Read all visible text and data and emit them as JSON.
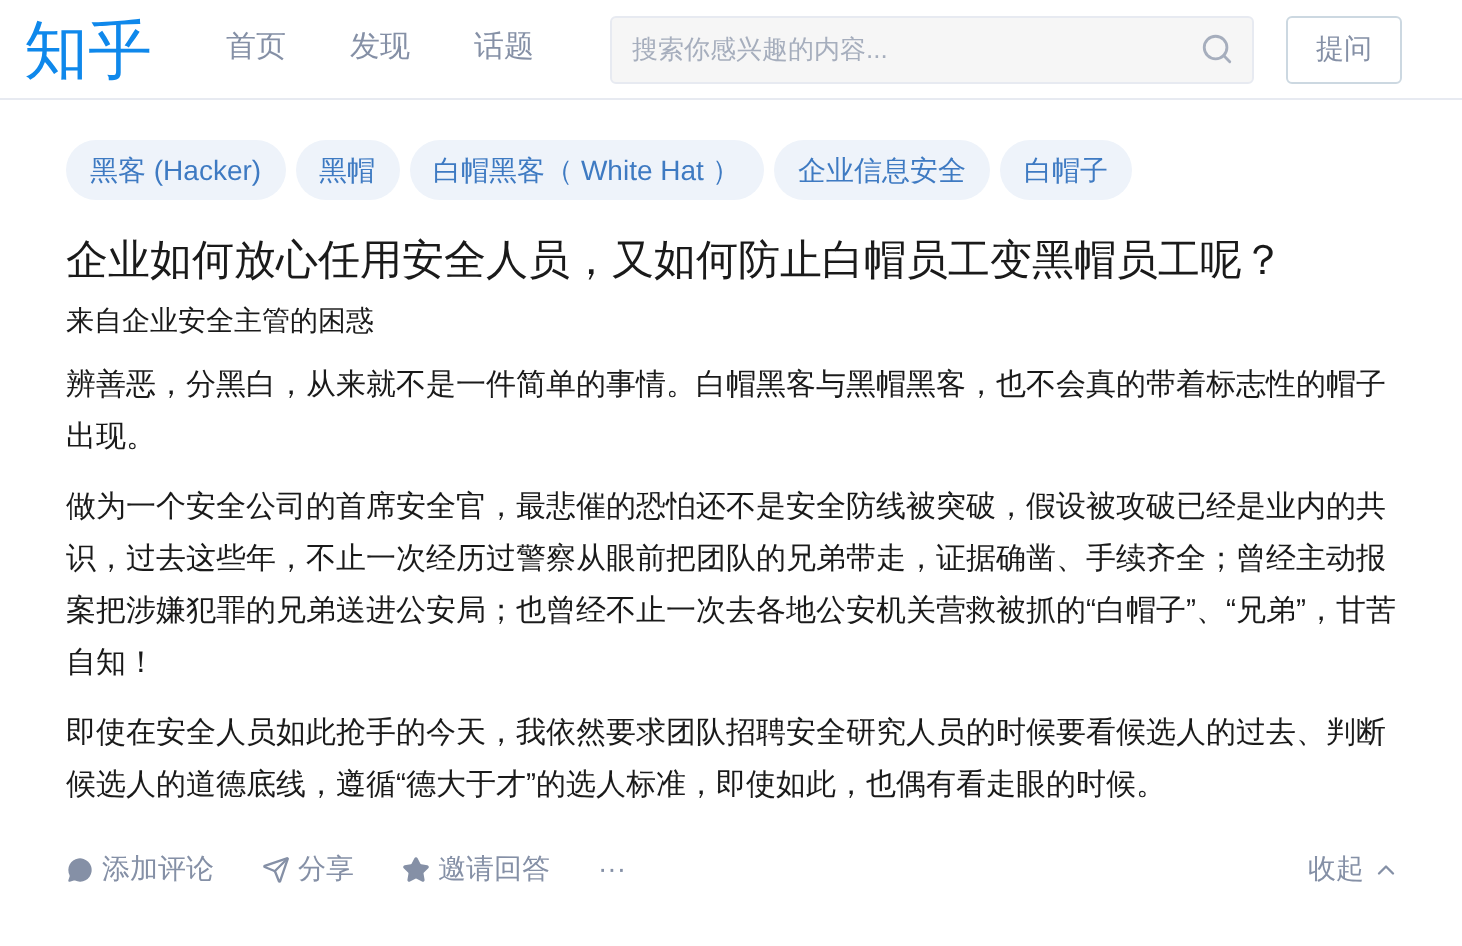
{
  "header": {
    "logo": "知乎",
    "nav": [
      {
        "label": "首页",
        "selected": false
      },
      {
        "label": "发现",
        "selected": false
      },
      {
        "label": "话题",
        "selected": false
      }
    ],
    "search": {
      "placeholder": "搜索你感兴趣的内容..."
    },
    "ask_button": "提问"
  },
  "question": {
    "topics": [
      "黑客 (Hacker)",
      "黑帽",
      "白帽黑客（ White Hat ）",
      "企业信息安全",
      "白帽子"
    ],
    "title": "企业如何放心任用安全人员，又如何防止白帽员工变黑帽员工呢？",
    "subtitle": "来自企业安全主管的困惑",
    "paragraphs": [
      "辨善恶，分黑白，从来就不是一件简单的事情。白帽黑客与黑帽黑客，也不会真的带着标志性的帽子出现。",
      "做为一个安全公司的首席安全官，最悲催的恐怕还不是安全防线被突破，假设被攻破已经是业内的共识，过去这些年，不止一次经历过警察从眼前把团队的兄弟带走，证据确凿、手续齐全；曾经主动报案把涉嫌犯罪的兄弟送进公安局；也曾经不止一次去各地公安机关营救被抓的“白帽子”、“兄弟”，甘苦自知！",
      "即使在安全人员如此抢手的今天，我依然要求团队招聘安全研究人员的时候要看候选人的过去、判断候选人的道德底线，遵循“德大于才”的选人标准，即使如此，也偶有看走眼的时候。"
    ],
    "actions": [
      {
        "kind": "comment",
        "label": "添加评论"
      },
      {
        "kind": "share",
        "label": "分享"
      },
      {
        "kind": "invite",
        "label": "邀请回答"
      },
      {
        "kind": "more",
        "label": "···"
      }
    ],
    "collapse": "收起"
  }
}
